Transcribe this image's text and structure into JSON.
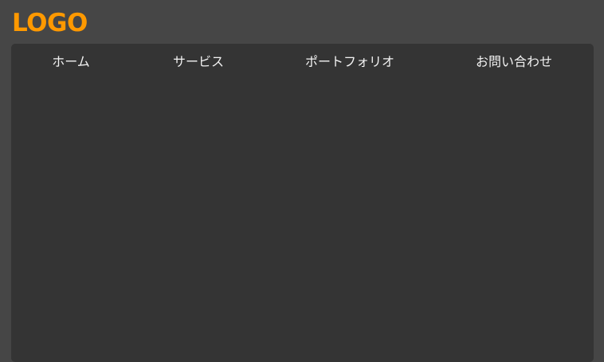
{
  "header": {
    "logo_text": "LOGO",
    "logo_color": "#ff9900"
  },
  "nav": {
    "items": [
      {
        "label": "ホーム"
      },
      {
        "label": "サービス"
      },
      {
        "label": "ポートフォリオ"
      },
      {
        "label": "お問い合わせ"
      }
    ]
  },
  "colors": {
    "page_background": "#464646",
    "panel_background": "#343434",
    "nav_text": "#f2f2f2"
  }
}
